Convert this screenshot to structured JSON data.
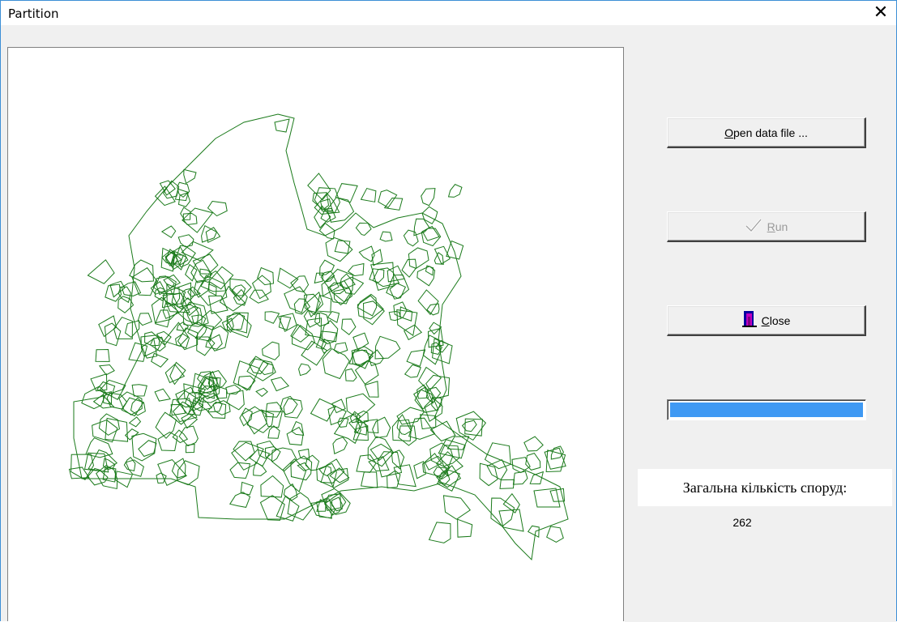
{
  "window": {
    "title": "Partition"
  },
  "buttons": {
    "open_label": "Open data file ...",
    "open_accel": "O",
    "open_rest": "pen data file ...",
    "run_label": "Run",
    "run_accel": "R",
    "run_rest": "un",
    "close_label": "Close",
    "close_accel": "C",
    "close_rest": "lose"
  },
  "progress": {
    "value": 1.0,
    "color": "#3f99f3"
  },
  "summary": {
    "label": "Загальна кількість споруд:",
    "count": "262"
  },
  "map": {
    "stroke_color": "#1a7a1a"
  },
  "icons": {
    "run": "check-icon",
    "close": "door-exit-icon",
    "window_close": "close-icon"
  }
}
